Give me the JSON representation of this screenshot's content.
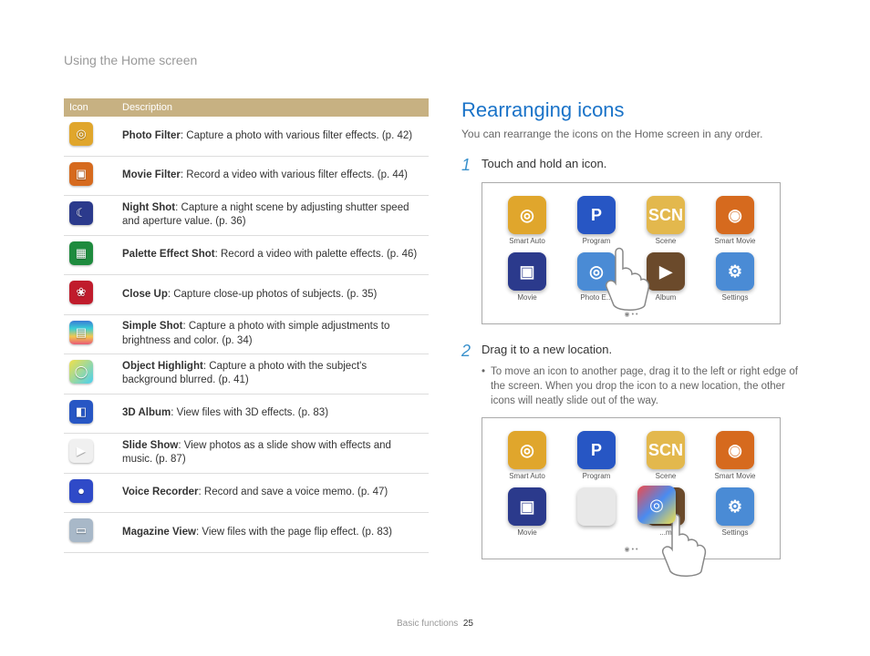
{
  "sectionTitle": "Using the Home screen",
  "table": {
    "headers": [
      "Icon",
      "Description"
    ],
    "rows": [
      {
        "bg": "#E0A62C",
        "glyph": "◎",
        "bold": "Photo Filter",
        "text": ": Capture a photo with various filter effects. (p. 42)"
      },
      {
        "bg": "#D66A1E",
        "glyph": "▣",
        "bold": "Movie Filter",
        "text": ": Record a video with various filter effects. (p. 44)"
      },
      {
        "bg": "#2B3A8C",
        "glyph": "☾",
        "bold": "Night Shot",
        "text": ": Capture a night scene by adjusting shutter speed and aperture value. (p. 36)"
      },
      {
        "bg": "#1E8B3E",
        "glyph": "▦",
        "bold": "Palette Effect Shot",
        "text": ": Record a video with palette effects. (p. 46)"
      },
      {
        "bg": "#C01C2C",
        "glyph": "❀",
        "bold": "Close Up",
        "text": ": Capture close-up photos of subjects. (p. 35)"
      },
      {
        "bg": "linear-gradient(#3a7bd5,#3acfd5,#f3c74e,#e85a77)",
        "glyph": "▤",
        "bold": "Simple Shot",
        "text": ": Capture a photo with simple adjustments to brightness and color. (p. 34)"
      },
      {
        "bg": "linear-gradient(135deg,#f0e04a,#4ad0f0)",
        "glyph": "◯",
        "bold": "Object Highlight",
        "text": ": Capture a photo with the subject's background blurred. (p. 41)"
      },
      {
        "bg": "#2756C4",
        "glyph": "◧",
        "bold": "3D Album",
        "text": ": View files with 3D effects. (p. 83)"
      },
      {
        "bg": "#F0F0F0",
        "glyph": "▶",
        "bold": "Slide Show",
        "text": ": View photos as a slide show with effects and music. (p. 87)"
      },
      {
        "bg": "#2F4AC8",
        "glyph": "●",
        "bold": "Voice Recorder",
        "text": ": Record and save a voice memo. (p. 47)"
      },
      {
        "bg": "#A8B8C8",
        "glyph": "▭",
        "bold": "Magazine View",
        "text": ": View files with the page flip effect. (p. 83)"
      }
    ]
  },
  "rearrange": {
    "title": "Rearranging icons",
    "intro": "You can rearrange the icons on the Home screen in any order.",
    "step1": {
      "num": "1",
      "text": "Touch and hold an icon."
    },
    "step2": {
      "num": "2",
      "text": "Drag it to a new location."
    },
    "bullet": "To move an icon to another page, drag it to the left or right edge of the screen. When you drop the icon to a new location, the other icons will neatly slide out of the way."
  },
  "apps": [
    {
      "label": "Smart Auto",
      "bg": "#E0A62C",
      "glyph": "◎"
    },
    {
      "label": "Program",
      "bg": "#2756C4",
      "glyph": "P"
    },
    {
      "label": "Scene",
      "bg": "#E3B84D",
      "glyph": "SCN"
    },
    {
      "label": "Smart Movie",
      "bg": "#D66A1E",
      "glyph": "◉"
    },
    {
      "label": "Movie",
      "bg": "#2B3A8C",
      "glyph": "▣"
    },
    {
      "label": "Photo E...",
      "bg": "#4a8bd5",
      "glyph": "◎"
    },
    {
      "label": "Album",
      "bg": "#6B4A2B",
      "glyph": "▶"
    },
    {
      "label": "Settings",
      "bg": "#4a8bd5",
      "glyph": "⚙"
    }
  ],
  "apps2": [
    {
      "label": "Smart Auto",
      "bg": "#E0A62C",
      "glyph": "◎"
    },
    {
      "label": "Program",
      "bg": "#2756C4",
      "glyph": "P"
    },
    {
      "label": "Scene",
      "bg": "#E3B84D",
      "glyph": "SCN"
    },
    {
      "label": "Smart Movie",
      "bg": "#D66A1E",
      "glyph": "◉"
    },
    {
      "label": "Movie",
      "bg": "#2B3A8C",
      "glyph": "▣"
    },
    {
      "label": "",
      "bg": "#E8E8E8",
      "glyph": ""
    },
    {
      "label": "...m",
      "bg": "#6B4A2B",
      "glyph": "▶"
    },
    {
      "label": "Settings",
      "bg": "#4a8bd5",
      "glyph": "⚙"
    }
  ],
  "footer": {
    "chapter": "Basic functions",
    "page": "25"
  }
}
